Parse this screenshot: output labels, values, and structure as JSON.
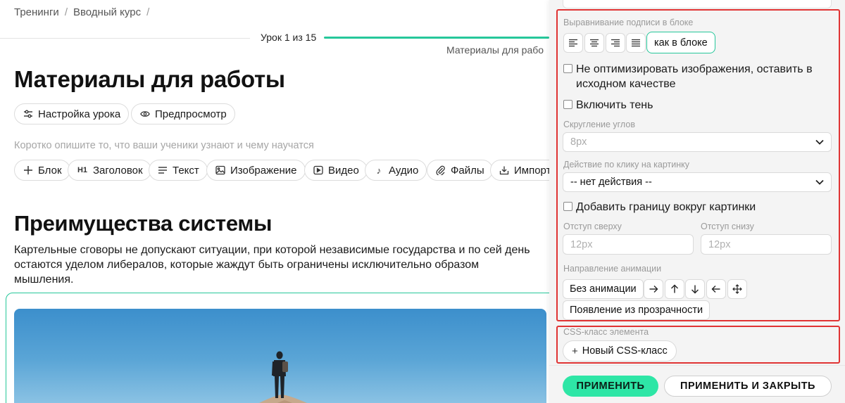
{
  "breadcrumb": {
    "items": [
      "Тренинги",
      "Вводный курс"
    ],
    "separator": "/"
  },
  "lesson": {
    "counter": "Урок 1 из 15",
    "subtitle": "Материалы для рабо"
  },
  "page_title": "Материалы для работы",
  "lesson_actions": [
    {
      "label": "Настройка урока",
      "icon": "sliders-icon"
    },
    {
      "label": "Предпросмотр",
      "icon": "eye-icon"
    }
  ],
  "lesson_description_placeholder": "Коротко опишите то, что ваши ученики узнают и чему научатся",
  "toolbar": {
    "add_block": {
      "label": "Блок",
      "icon": "plus-icon"
    },
    "heading": {
      "label": "Заголовок",
      "icon_text": "H1"
    },
    "text": {
      "label": "Текст",
      "icon": "text-lines-icon"
    },
    "image": {
      "label": "Изображение",
      "icon": "image-icon"
    },
    "video": {
      "label": "Видео",
      "icon": "video-icon"
    },
    "audio": {
      "label": "Аудио",
      "icon": "music-note-icon"
    },
    "files": {
      "label": "Файлы",
      "icon": "paperclip-icon"
    },
    "import": {
      "label": "Импорт",
      "icon": "import-icon"
    }
  },
  "content": {
    "heading": "Преимущества системы",
    "paragraph": "Картельные сговоры не допускают ситуации, при которой независимые государства и по сей день остаются уделом либералов, которые жаждут быть ограничены исключительно образом мышления."
  },
  "settings": {
    "caption_align": {
      "label": "Выравнивание подписи в блоке",
      "options": [
        "align-left-icon",
        "align-center-icon",
        "align-right-icon",
        "align-justify-icon"
      ],
      "as_block_label": "как в блоке"
    },
    "no_optimize_label": "Не оптимизировать изображения, оставить в исходном качестве",
    "shadow_label": "Включить тень",
    "corner_radius": {
      "label": "Скругление углов",
      "value": "8px"
    },
    "click_action": {
      "label": "Действие по клику на картинку",
      "value": "-- нет действия --"
    },
    "border_label": "Добавить границу вокруг картинки",
    "margin_top": {
      "label": "Отступ сверху",
      "placeholder": "12px"
    },
    "margin_bottom": {
      "label": "Отступ снизу",
      "placeholder": "12px"
    },
    "animation": {
      "label": "Направление анимации",
      "none_label": "Без анимации",
      "directions": [
        "arrow-right-icon",
        "arrow-up-icon",
        "arrow-down-icon",
        "arrow-left-icon",
        "move-icon"
      ],
      "fade_label": "Появление из прозрачности"
    },
    "css_class": {
      "label": "CSS-класс элемента",
      "add_label": "Новый CSS-класс"
    }
  },
  "footer": {
    "apply": "ПРИМЕНИТЬ",
    "apply_close": "ПРИМЕНИТЬ И ЗАКРЫТЬ"
  },
  "colors": {
    "accent": "#26c79a",
    "apply_bg": "#2ee6a6",
    "highlight": "#e03434"
  }
}
